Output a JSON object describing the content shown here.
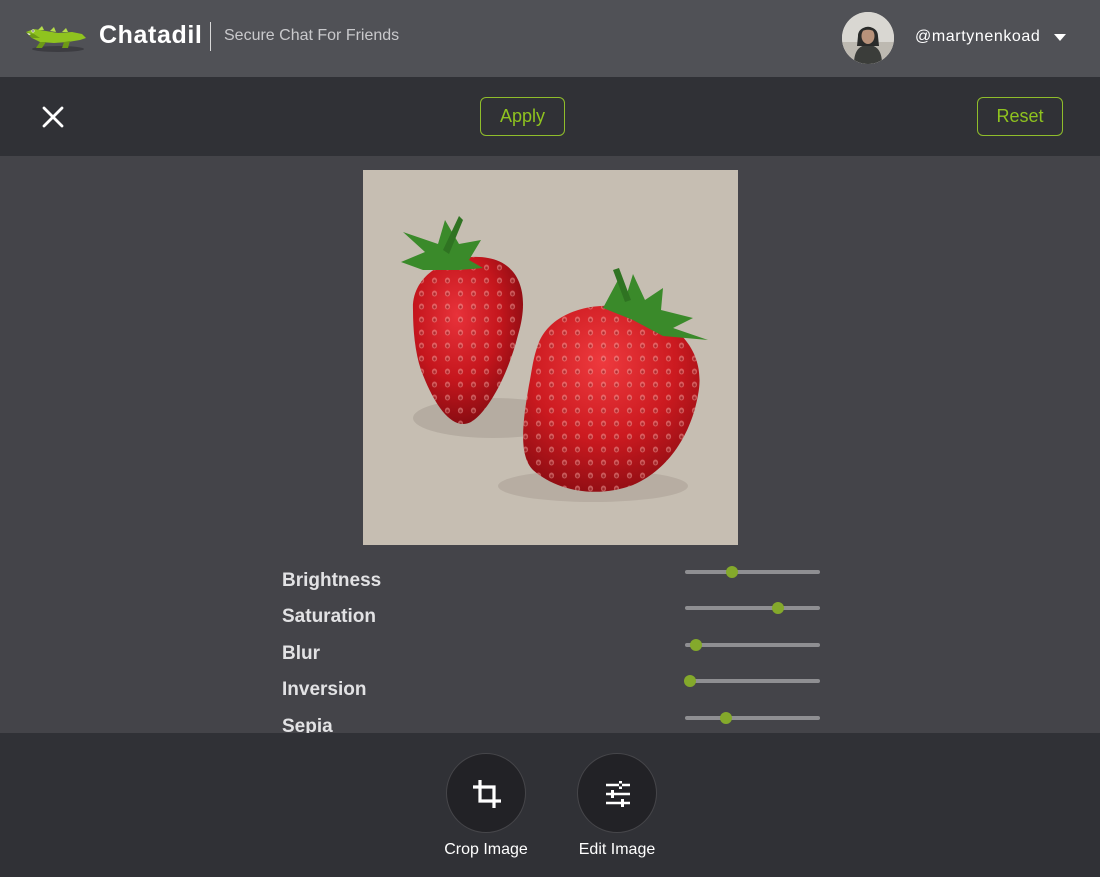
{
  "navbar": {
    "logo_icon": "crocodile-logo-icon",
    "brand": "Chatadil",
    "tagline": "Secure Chat For Friends",
    "username": "@martynenkoad",
    "user_menu_icon": "caret-down-icon"
  },
  "toolbar": {
    "close_icon": "close-icon",
    "apply_label": "Apply",
    "reset_label": "Reset"
  },
  "preview": {
    "subject": "strawberries-photo"
  },
  "adjustments": [
    {
      "label": "Brightness",
      "value": 0.35
    },
    {
      "label": "Saturation",
      "value": 0.69
    },
    {
      "label": "Blur",
      "value": 0.08
    },
    {
      "label": "Inversion",
      "value": 0.04
    },
    {
      "label": "Sepia",
      "value": 0.3
    }
  ],
  "tools": {
    "crop": {
      "label": "Crop Image",
      "icon": "crop-icon"
    },
    "edit": {
      "label": "Edit Image",
      "icon": "sliders-icon"
    }
  },
  "colors": {
    "accent": "#8fc31f",
    "slider_thumb": "#84a92b",
    "navbar_bg": "#505156",
    "toolbar_bg": "#303136",
    "content_bg": "#444449"
  }
}
